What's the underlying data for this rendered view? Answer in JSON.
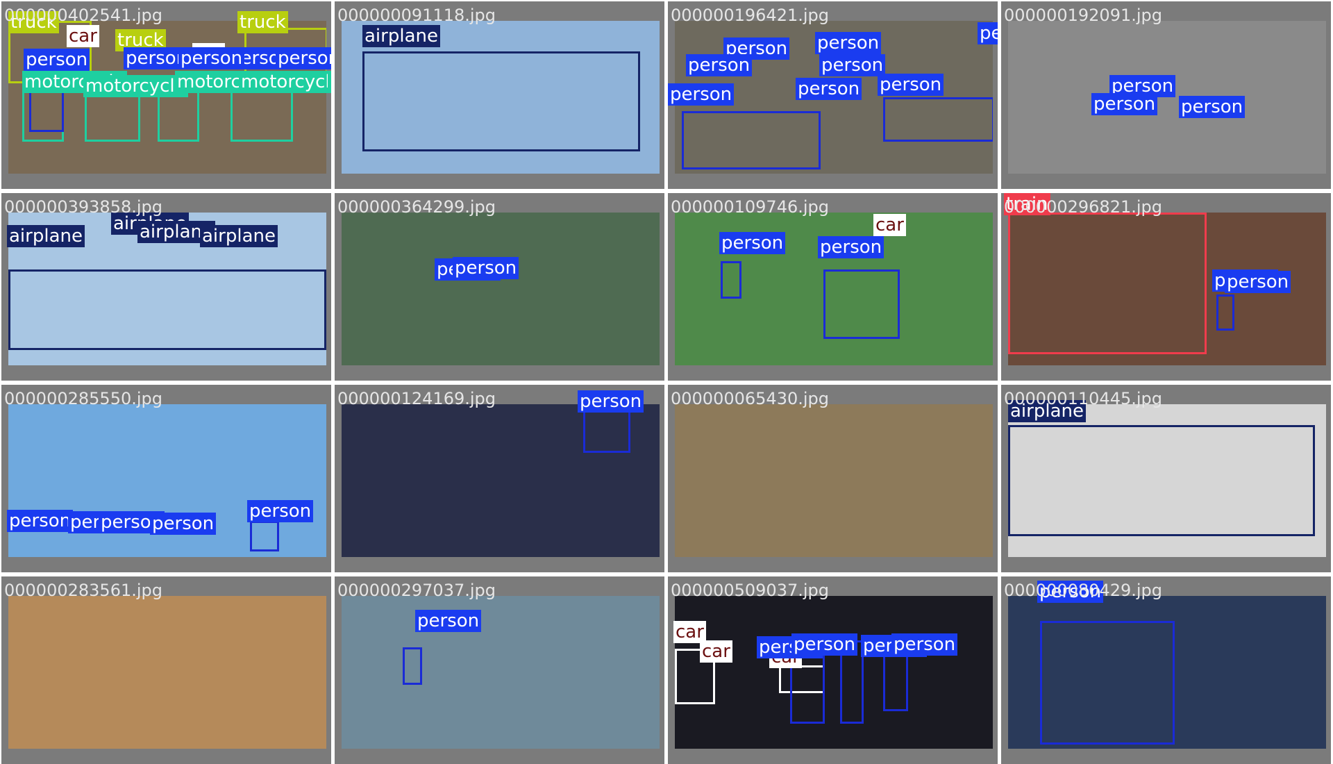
{
  "tiles": [
    {
      "file": "000000402541.jpg",
      "bg": "#7a6a55",
      "labels": [
        "truck",
        "car",
        "truck",
        "truck",
        "person",
        "person",
        "person",
        "car",
        "person",
        "person",
        "motorcycle",
        "motorcycle",
        "motorcycle",
        "motorcycle",
        "motorcycle"
      ]
    },
    {
      "file": "000000091118.jpg",
      "bg": "#8fb3d9",
      "labels": [
        "airplane"
      ]
    },
    {
      "file": "000000196421.jpg",
      "bg": "#6e6a5e",
      "labels": [
        "person",
        "person",
        "person",
        "person",
        "person",
        "person",
        "person",
        "person"
      ]
    },
    {
      "file": "000000192091.jpg",
      "bg": "#8a8a8a",
      "labels": [
        "person",
        "person",
        "person"
      ]
    },
    {
      "file": "000000393858.jpg",
      "bg": "#a8c6e3",
      "labels": [
        "airplane",
        "airplane",
        "airplane",
        "airplane"
      ]
    },
    {
      "file": "000000364299.jpg",
      "bg": "#4f6b52",
      "labels": [
        "person",
        "person"
      ]
    },
    {
      "file": "000000109746.jpg",
      "bg": "#4f8a4a",
      "labels": [
        "car",
        "person",
        "person"
      ]
    },
    {
      "file": "000000296821.jpg",
      "bg": "#6a4a3a",
      "labels": [
        "train",
        "person",
        "person"
      ]
    },
    {
      "file": "000000285550.jpg",
      "bg": "#6fa9de",
      "labels": [
        "person",
        "person",
        "person",
        "person",
        "person"
      ]
    },
    {
      "file": "000000124169.jpg",
      "bg": "#2a2f4a",
      "labels": [
        "person"
      ]
    },
    {
      "file": "000000065430.jpg",
      "bg": "#8d7a5a",
      "labels": []
    },
    {
      "file": "000000110445.jpg",
      "bg": "#d6d6d6",
      "labels": [
        "airplane"
      ]
    },
    {
      "file": "000000283561.jpg",
      "bg": "#b58a5a",
      "labels": []
    },
    {
      "file": "000000297037.jpg",
      "bg": "#6f8a9a",
      "labels": [
        "person"
      ]
    },
    {
      "file": "000000509037.jpg",
      "bg": "#1a1a22",
      "labels": [
        "car",
        "car",
        "car",
        "person",
        "person",
        "person",
        "person"
      ]
    },
    {
      "file": "000000080429.jpg",
      "bg": "#2a3a5a",
      "labels": [
        "person"
      ]
    }
  ],
  "colors": {
    "person": "#1a3cf0",
    "airplane": "#152466",
    "car": "#ffffff",
    "truck": "#b8cf10",
    "motorcycle": "#1ecfa0",
    "train": "#f03c4c",
    "tile_bg": "#7b7b7b"
  }
}
